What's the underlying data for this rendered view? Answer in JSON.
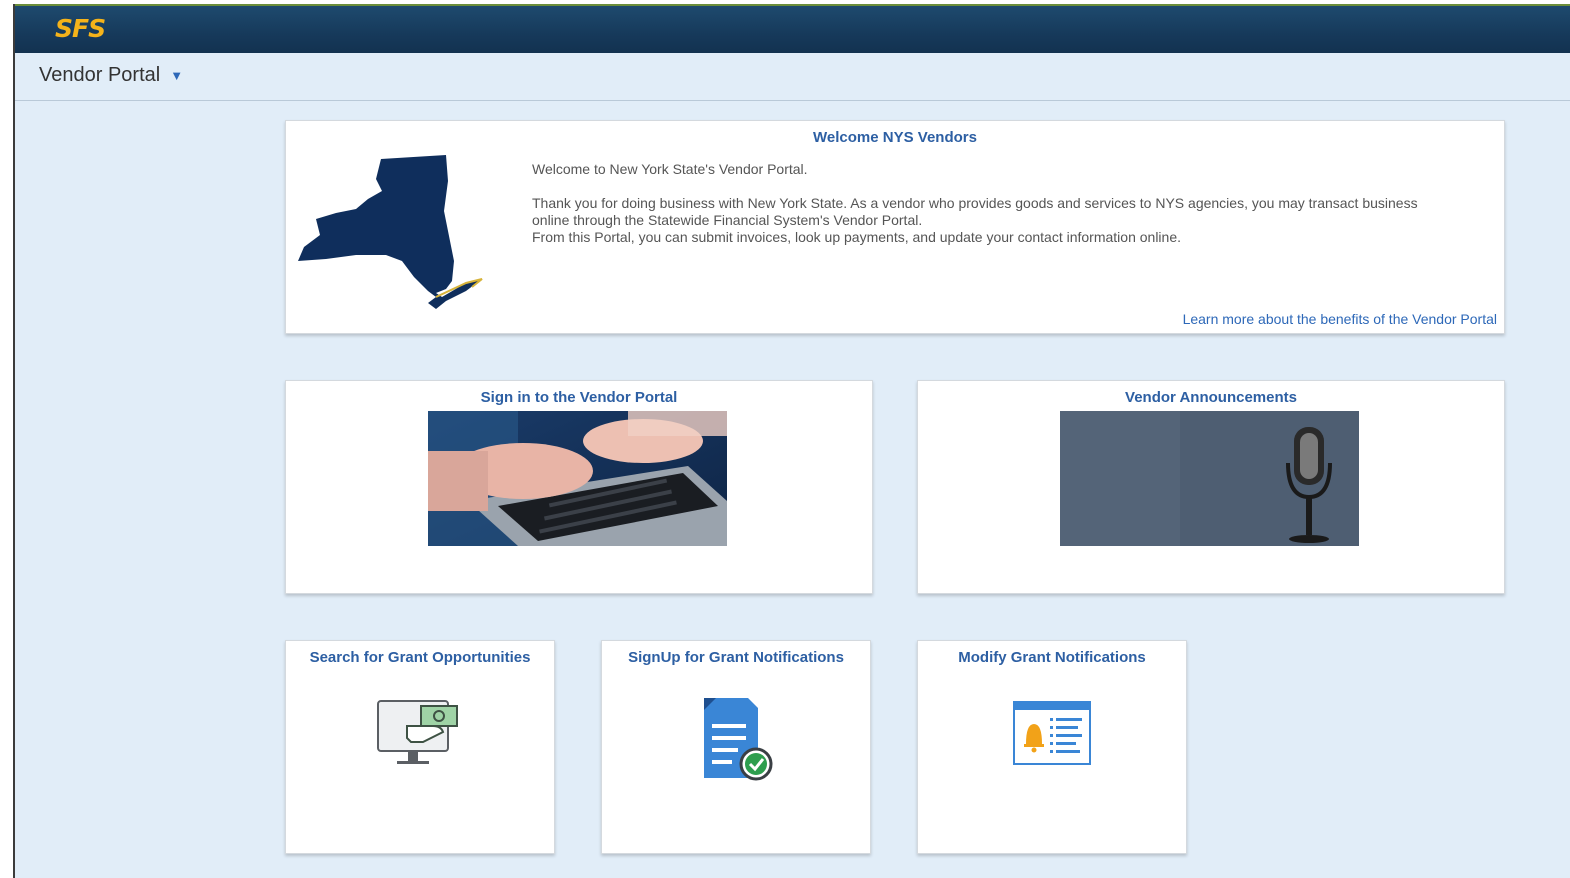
{
  "header": {
    "logo": "SFS"
  },
  "nav": {
    "title": "Vendor Portal",
    "caret": "▼"
  },
  "welcome": {
    "title": "Welcome NYS Vendors",
    "intro": "Welcome to New York State's Vendor Portal.",
    "body_line1": "Thank you for doing business with New York State. As a vendor who provides goods and services to NYS agencies, you may transact business online through the Statewide Financial System's Vendor Portal.",
    "body_line2": "From this Portal, you can submit invoices, look up payments, and update your contact information online.",
    "link": "Learn more about the benefits of the Vendor Portal"
  },
  "tiles": {
    "signin": {
      "title": "Sign in to the Vendor Portal",
      "icon": "laptop-typing-photo"
    },
    "announcements": {
      "title": "Vendor Announcements",
      "icon": "microphone-photo"
    },
    "grant_search": {
      "title": "Search for Grant Opportunities",
      "icon": "monitor-money-hand-icon"
    },
    "grant_signup": {
      "title": "SignUp for Grant Notifications",
      "icon": "document-check-icon"
    },
    "grant_modify": {
      "title": "Modify Grant Notifications",
      "icon": "bell-list-icon"
    }
  },
  "colors": {
    "header_bg": "#16395a",
    "logo": "#f5b31a",
    "page_bg": "#e1edf8",
    "link": "#2d5fa3",
    "map": "#0f2e5c"
  }
}
